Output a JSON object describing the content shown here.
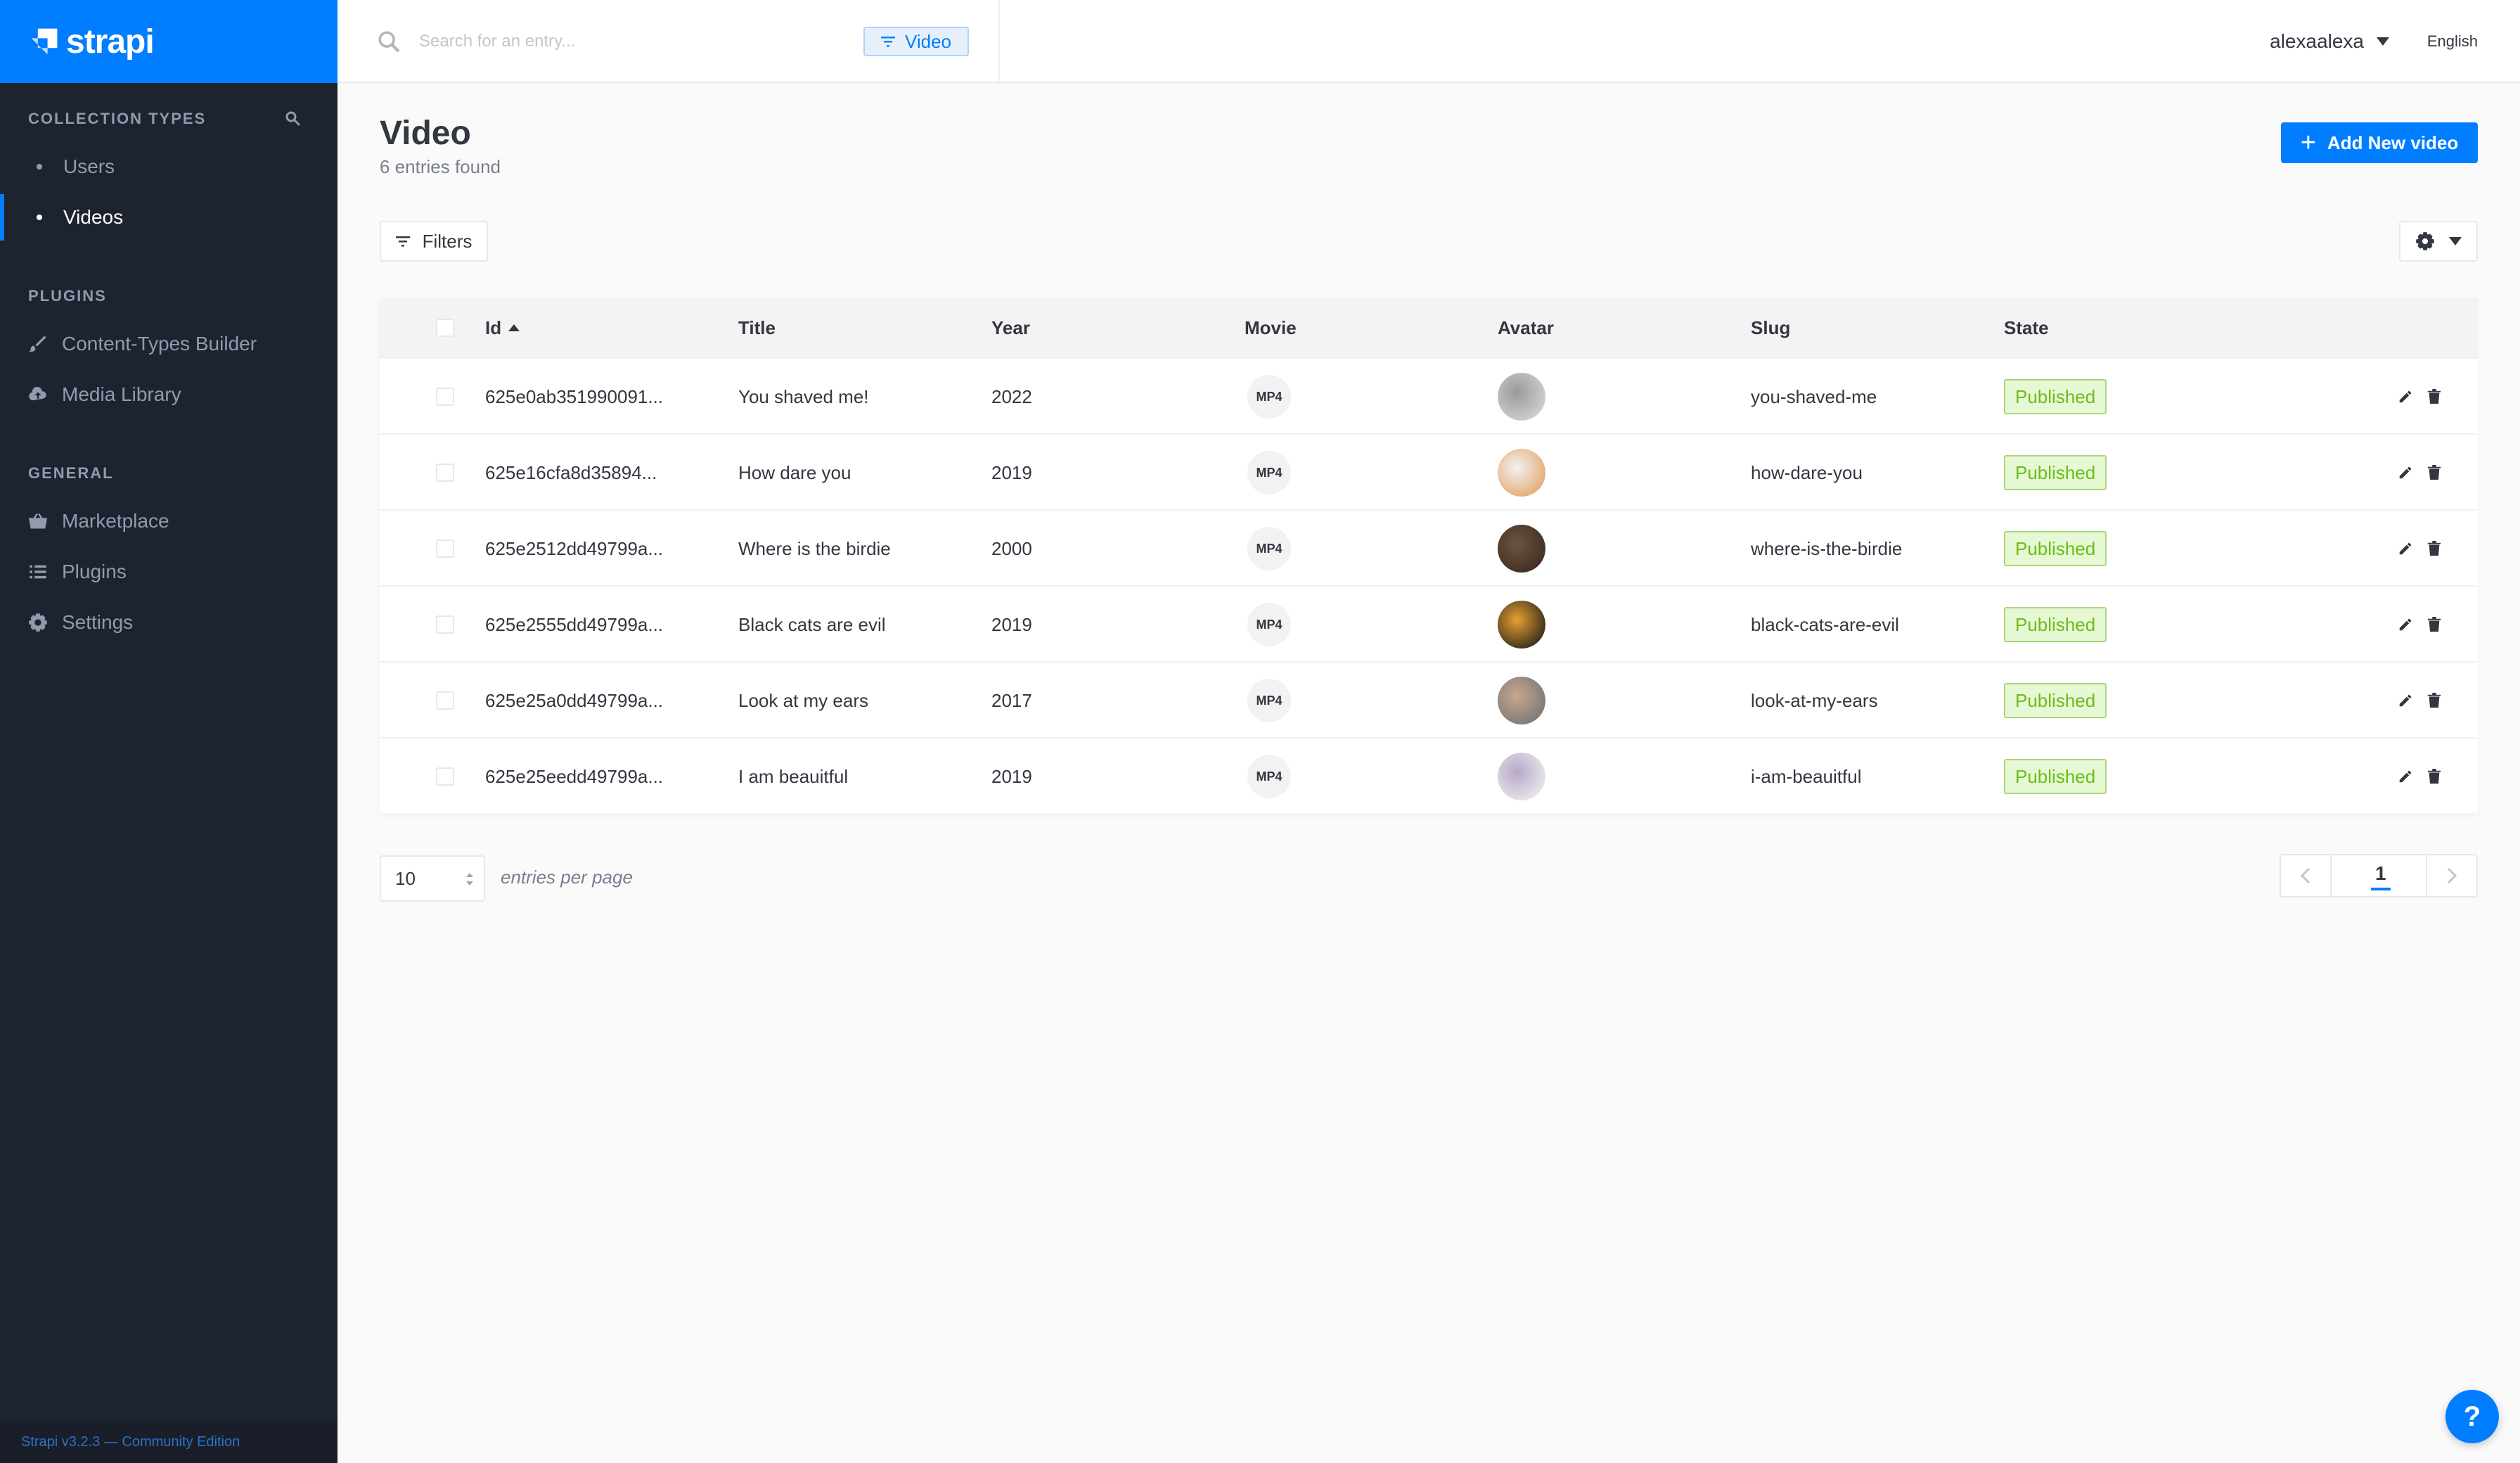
{
  "app": {
    "name": "strapi",
    "footer": "Strapi v3.2.3 — Community Edition"
  },
  "sidebar": {
    "collection_types_title": "Collection Types",
    "collection_types": [
      {
        "label": "Users",
        "active": false
      },
      {
        "label": "Videos",
        "active": true
      }
    ],
    "plugins_title": "Plugins",
    "plugins": [
      {
        "label": "Content-Types Builder",
        "icon": "paintbrush-icon"
      },
      {
        "label": "Media Library",
        "icon": "cloud-upload-icon"
      }
    ],
    "general_title": "General",
    "general": [
      {
        "label": "Marketplace",
        "icon": "basket-icon"
      },
      {
        "label": "Plugins",
        "icon": "list-icon"
      },
      {
        "label": "Settings",
        "icon": "gear-icon"
      }
    ]
  },
  "topbar": {
    "search_placeholder": "Search for an entry...",
    "search_value": "",
    "filter_chip": "Video",
    "username": "alexaalexa",
    "language": "English"
  },
  "header": {
    "title": "Video",
    "subtitle": "6 entries found",
    "add_button": "Add New video",
    "filters_button": "Filters"
  },
  "table": {
    "columns": [
      "Id",
      "Title",
      "Year",
      "Movie",
      "Avatar",
      "Slug",
      "State"
    ],
    "sort_column": "Id",
    "sort_direction": "asc",
    "rows": [
      {
        "id": "625e0ab351990091...",
        "title": "You shaved me!",
        "year": "2022",
        "movie": "MP4",
        "avatar_colors": [
          "#9a9a9a",
          "#d8d8d8"
        ],
        "slug": "you-shaved-me",
        "state": "Published"
      },
      {
        "id": "625e16cfa8d35894...",
        "title": "How dare you",
        "year": "2019",
        "movie": "MP4",
        "avatar_colors": [
          "#f2f2f2",
          "#e0a060"
        ],
        "slug": "how-dare-you",
        "state": "Published"
      },
      {
        "id": "625e2512dd49799a...",
        "title": "Where is the birdie",
        "year": "2000",
        "movie": "MP4",
        "avatar_colors": [
          "#6b5340",
          "#3b2a20"
        ],
        "slug": "where-is-the-birdie",
        "state": "Published"
      },
      {
        "id": "625e2555dd49799a...",
        "title": "Black cats are evil",
        "year": "2019",
        "movie": "MP4",
        "avatar_colors": [
          "#e8a030",
          "#1a1a1a"
        ],
        "slug": "black-cats-are-evil",
        "state": "Published"
      },
      {
        "id": "625e25a0dd49799a...",
        "title": "Look at my ears",
        "year": "2017",
        "movie": "MP4",
        "avatar_colors": [
          "#c8a890",
          "#707070"
        ],
        "slug": "look-at-my-ears",
        "state": "Published"
      },
      {
        "id": "625e25eedd49799a...",
        "title": "I am beauitful",
        "year": "2019",
        "movie": "MP4",
        "avatar_colors": [
          "#b8a8c8",
          "#f0f0f0"
        ],
        "slug": "i-am-beauitful",
        "state": "Published"
      }
    ]
  },
  "pagination": {
    "per_page": "10",
    "per_page_label": "entries per page",
    "current_page": "1"
  },
  "colors": {
    "accent": "#007eff",
    "sidebar_bg": "#1e2330",
    "published_bg": "#e6f8d4",
    "published_text": "#6dbb1a"
  }
}
